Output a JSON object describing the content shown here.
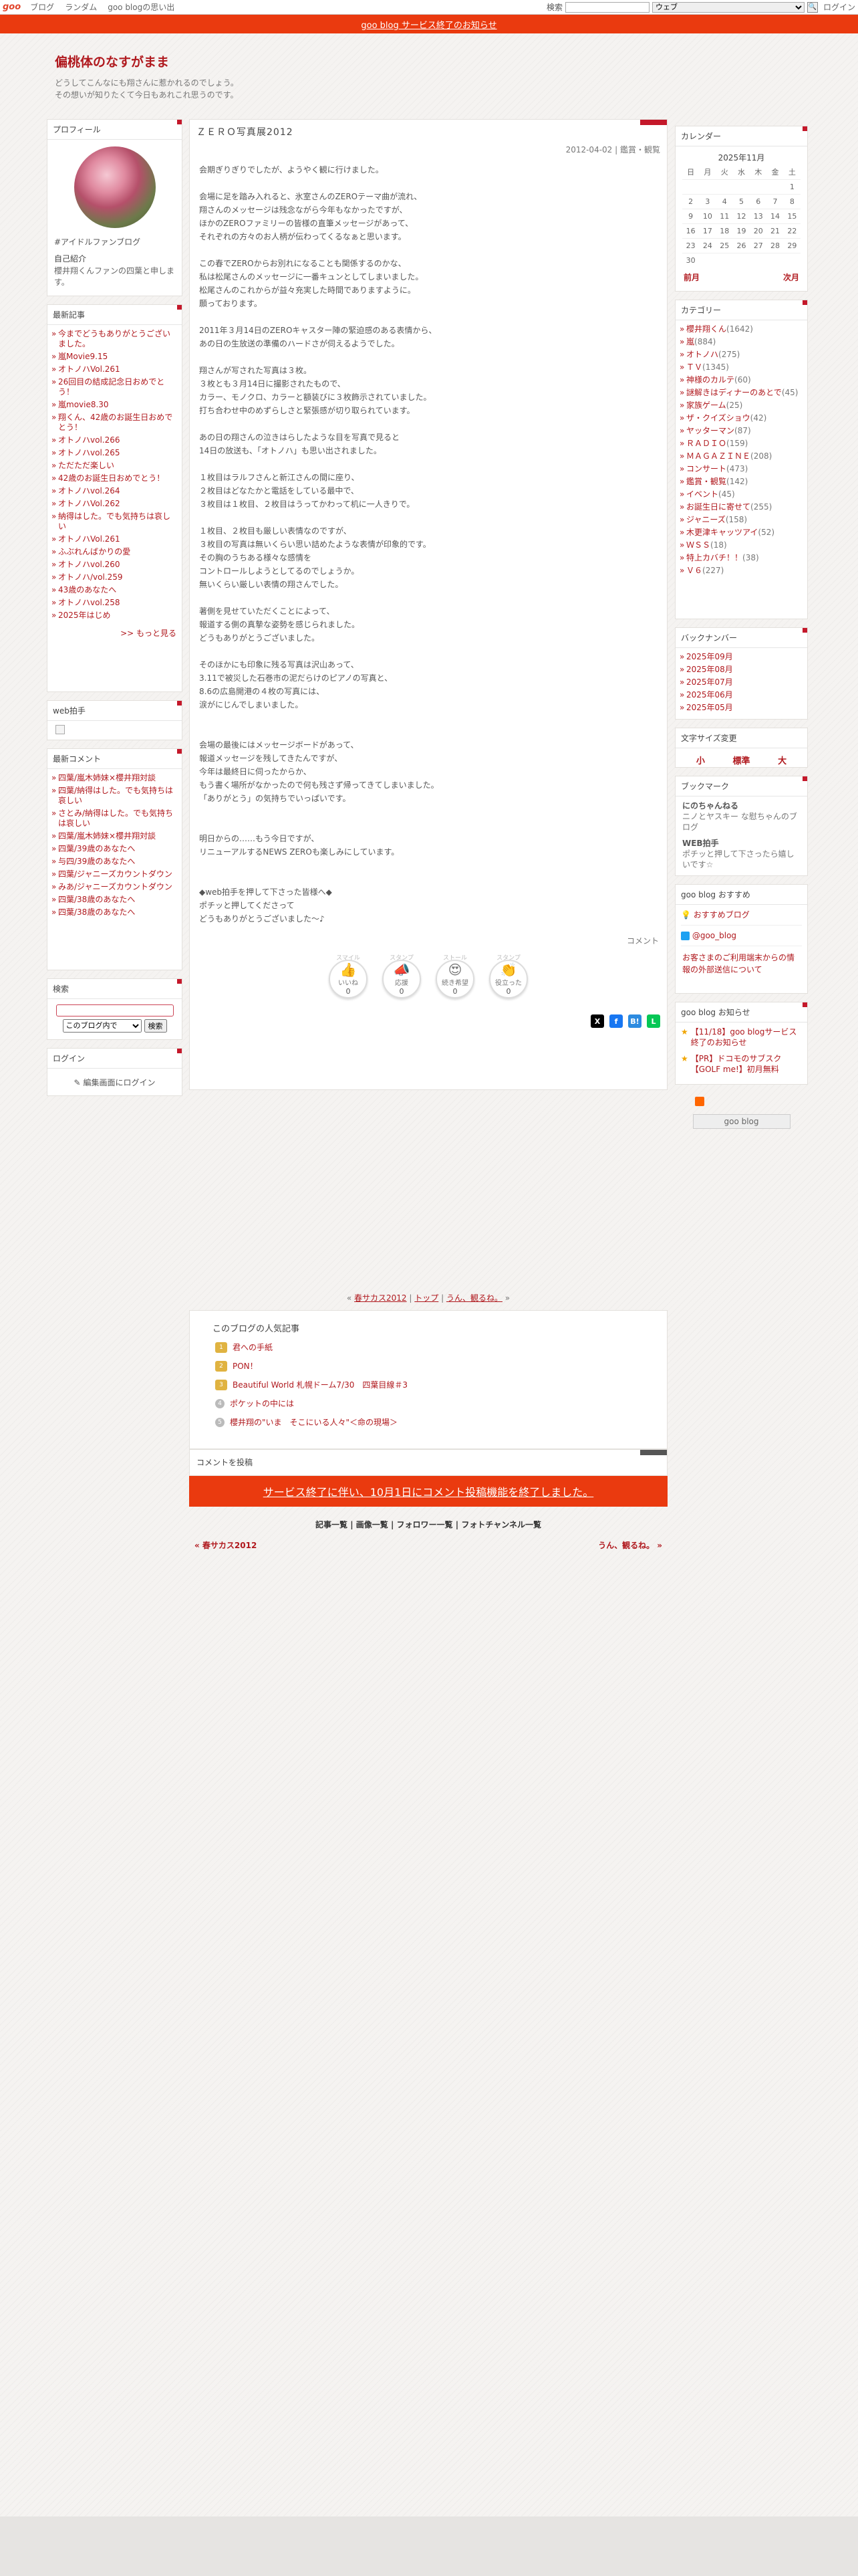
{
  "topbar": {
    "logo": "goo",
    "links": [
      "ブログ",
      "ランダム",
      "goo blogの思い出"
    ],
    "search_label": "検索",
    "search_scope": "ウェブ",
    "login": "ログイン"
  },
  "notice": "goo blog サービス終了のお知らせ",
  "blog": {
    "title": "偏桃体のなすがまま",
    "desc1": "どうしてこんなにも翔さんに惹かれるのでしょう。",
    "desc2": "その想いが知りたくて今日もあれこれ思うのです。"
  },
  "profile": {
    "heading": "プロフィール",
    "link": "#アイドルファンブログ",
    "intro_title": "自己紹介",
    "intro": "櫻井翔くんファンの四葉と申します。"
  },
  "recent": {
    "heading": "最新記事",
    "items": [
      "今までどうもありがとうございました。",
      "嵐Movie9.15",
      "オトノハVol.261",
      "26回目の結成記念日おめでとう！",
      "嵐movie8.30",
      "翔くん、42歳のお誕生日おめでとう！",
      "オトノハvol.266",
      "オトノハvol.265",
      "ただただ楽しい",
      "42歳のお誕生日おめでとう！",
      "オトノハvol.264",
      "オトノハVol.262",
      "納得はした。でも気持ちは哀しい",
      "オトノハVol.261",
      "ふぶれんばかりの愛",
      "オトノハvol.260",
      "オトノハ/vol.259",
      "43歳のあなたへ",
      "オトノハvol.258",
      "2025年はじめ"
    ],
    "more": ">> もっと見る"
  },
  "webclap": {
    "heading": "web拍手"
  },
  "comments": {
    "heading": "最新コメント",
    "items": [
      "四葉/嵐木姉妹×櫻井翔対談",
      "四葉/納得はした。でも気持ちは哀しい",
      "さとみ/納得はした。でも気持ちは哀しい",
      "四葉/嵐木姉妹×櫻井翔対談",
      "四葉/39歳のあなたへ",
      "与四/39歳のあなたへ",
      "四葉/ジャニーズカウントダウン",
      "みあ/ジャニーズカウントダウン",
      "四葉/38歳のあなたへ",
      "四葉/38歳のあなたへ"
    ]
  },
  "search": {
    "heading": "検索",
    "scope": "このブログ内で",
    "button": "検索"
  },
  "login": {
    "heading": "ログイン",
    "link": "編集画面にログイン"
  },
  "entry": {
    "title": "ＺＥＲＯ写真展2012",
    "date": "2012-04-02",
    "category": "鑑賞・観覧",
    "lines": [
      "会期ぎりぎりでしたが、ようやく観に行けました。",
      "",
      "会場に足を踏み入れると、氷室さんのZEROテーマ曲が流れ、",
      "翔さんのメッセージは残念ながら今年もなかったですが、",
      "ほかのZEROファミリーの皆様の直筆メッセージがあって、",
      "それぞれの方々のお人柄が伝わってくるなぁと思います。",
      "",
      "この春でZEROからお別れになることも関係するのかな、",
      "私は松尾さんのメッセージに一番キュンとしてしまいました。",
      "松尾さんのこれからが益々充実した時間でありますように。",
      "願っております。",
      "",
      "2011年３月14日のZEROキャスター陣の緊迫感のある表情から、",
      "あの日の生放送の準備のハードさが伺えるようでした。",
      "",
      "翔さんが写された写真は３枚。",
      "３枚とも３月14日に撮影されたもので、",
      "カラー、モノクロ、カラーと額装びに３枚飾示されていました。",
      "打ち合わせ中のめずらしさと緊張感が切り取られています。",
      "",
      "あの日の翔さんの泣きはらしたような目を写真で見ると",
      "14日の放送も、「オトノハ」も思い出されました。",
      "",
      "１枚目はラルフさんと新江さんの間に座り、",
      "２枚目はどなたかと電話をしている最中で、",
      "３枚目は１枚目、２枚目はうってかわって机に一人きりで。",
      "",
      "１枚目、２枚目も厳しい表情なのですが、",
      "３枚目の写真は無いくらい思い詰めたような表情が印象的です。",
      "その胸のうちある様々な感情を",
      "コントロールしようとしてるのでしょうか。",
      "無いくらい厳しい表情の翔さんでした。",
      "",
      "著側を見せていただくことによって、",
      "報道する側の真摯な姿勢を感じられました。",
      "どうもありがとうございました。",
      "",
      "そのほかにも印象に残る写真は沢山あって、",
      "3.11で被災した石巻市の泥だらけのピアノの写真と、",
      "8.6の広島開港の４枚の写真には、",
      "涙がにじんでしまいました。",
      "",
      "",
      "会場の最後にはメッセージボードがあって、",
      "報道メッセージを残してきたんですが、",
      "今年は最終日に伺ったからか、",
      "もう書く場所がなかったので何も残さず帰ってきてしまいました。",
      "「ありがとう」の気持ちでいっぱいです。",
      "",
      "",
      "明日からの……もう今日ですが、",
      "リニューアルするNEWS ZEROも楽しみにしています。",
      "",
      "",
      "◆web拍手を押して下さった皆様へ◆",
      "ポチッと押してくださって",
      "どうもありがとうございました～♪"
    ],
    "comment_link": "コメント"
  },
  "reactions": [
    {
      "top": "スマイル",
      "icon": "👍",
      "label": "いいね",
      "count": "0"
    },
    {
      "top": "スタンプ",
      "icon": "📣",
      "label": "応援",
      "count": "0"
    },
    {
      "top": "ストール",
      "icon": "😍",
      "label": "続き希望",
      "count": "0"
    },
    {
      "top": "スタンプ",
      "icon": "👏",
      "label": "役立った",
      "count": "0"
    }
  ],
  "nav": {
    "prev": "春サカス2012",
    "top": "トップ",
    "next": "うん、観るね。"
  },
  "popular": {
    "heading": "このブログの人気記事",
    "items": [
      "君への手紙",
      "PON！",
      "Beautiful World 札幌ドーム7/30　四葉目線＃3",
      "ポケットの中には",
      "櫻井翔の\"いま　そこにいる人々\"＜命の現場＞"
    ]
  },
  "post_comment": {
    "heading": "コメントを投稿",
    "notice": "サービス終了に伴い、10月1日にコメント投稿機能を終了しました。"
  },
  "footer_links": [
    "記事一覧",
    "画像一覧",
    "フォロワー一覧",
    "フォトチャンネル一覧"
  ],
  "pager": {
    "prev": "« 春サカス2012",
    "next": "うん、観るね。 »"
  },
  "calendar": {
    "heading": "カレンダー",
    "month": "2025年11月",
    "dow": [
      "日",
      "月",
      "火",
      "水",
      "木",
      "金",
      "土"
    ],
    "weeks": [
      [
        "",
        "",
        "",
        "",
        "",
        "",
        "1"
      ],
      [
        "2",
        "3",
        "4",
        "5",
        "6",
        "7",
        "8"
      ],
      [
        "9",
        "10",
        "11",
        "12",
        "13",
        "14",
        "15"
      ],
      [
        "16",
        "17",
        "18",
        "19",
        "20",
        "21",
        "22"
      ],
      [
        "23",
        "24",
        "25",
        "26",
        "27",
        "28",
        "29"
      ],
      [
        "30",
        "",
        "",
        "",
        "",
        "",
        ""
      ]
    ],
    "prev": "前月",
    "next": "次月"
  },
  "categories": {
    "heading": "カテゴリー",
    "items": [
      [
        "櫻井翔くん",
        "(1642)"
      ],
      [
        "嵐",
        "(884)"
      ],
      [
        "オトノハ",
        "(275)"
      ],
      [
        "ＴＶ",
        "(1345)"
      ],
      [
        "神様のカルテ",
        "(60)"
      ],
      [
        "謎解きはディナーのあとで",
        "(45)"
      ],
      [
        "家族ゲーム",
        "(25)"
      ],
      [
        "ザ・クイズショウ",
        "(42)"
      ],
      [
        "ヤッターマン",
        "(87)"
      ],
      [
        "ＲＡＤＩＯ",
        "(159)"
      ],
      [
        "ＭＡＧＡＺＩＮＥ",
        "(208)"
      ],
      [
        "コンサート",
        "(473)"
      ],
      [
        "鑑賞・観覧",
        "(142)"
      ],
      [
        "イベント",
        "(45)"
      ],
      [
        "お誕生日に寄せて",
        "(255)"
      ],
      [
        "ジャニーズ",
        "(158)"
      ],
      [
        "木更津キャッツアイ",
        "(52)"
      ],
      [
        "ＷＳＳ",
        "(18)"
      ],
      [
        "特上カバチ！！",
        "(38)"
      ],
      [
        "Ｖ６",
        "(227)"
      ]
    ]
  },
  "backnumber": {
    "heading": "バックナンバー",
    "items": [
      "2025年09月",
      "2025年08月",
      "2025年07月",
      "2025年06月",
      "2025年05月"
    ]
  },
  "fontsize": {
    "heading": "文字サイズ変更",
    "small": "小",
    "normal": "標準",
    "large": "大"
  },
  "bookmark": {
    "heading": "ブックマーク",
    "items": [
      {
        "name": "にのちゃんねる",
        "desc": "ニノとヤスキー な慰ちゃんのブログ"
      },
      {
        "name": "WEB拍手",
        "desc": "ポチッと押して下さったら嬉しいです☆"
      }
    ]
  },
  "recommend": {
    "heading": "goo blog おすすめ",
    "items": [
      "おすすめブログ",
      "@goo_blog"
    ],
    "contact": "お客さまのご利用端末からの情報の外部送信について"
  },
  "news": {
    "heading": "goo blog お知らせ",
    "items": [
      "【11/18】goo blogサービス終了のお知らせ",
      "【PR】ドコモのサブスク【GOLF me!】初月無料"
    ]
  },
  "footer": {
    "badge": "goo blog"
  }
}
